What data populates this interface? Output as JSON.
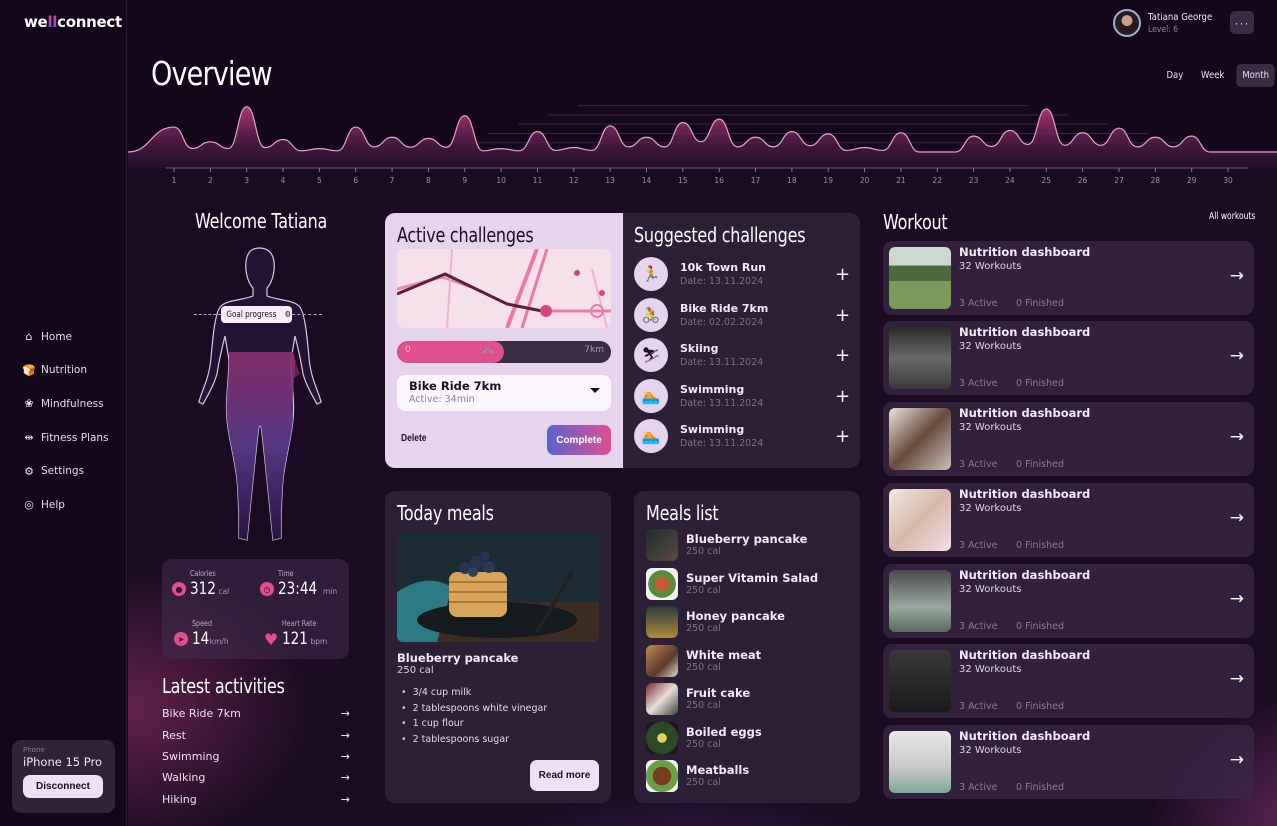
{
  "app": {
    "logo_prefix": "we",
    "logo_accent": "ll",
    "logo_suffix": "connect"
  },
  "user": {
    "name": "Tatiana George",
    "level": "Level: 6",
    "more_label": "···"
  },
  "header": {
    "title": "Overview",
    "ranges": [
      "Day",
      "Week",
      "Month"
    ],
    "active_range": "Month"
  },
  "sidebar": {
    "items": [
      {
        "label": "Home",
        "icon": "home-icon",
        "glyph": "⌂"
      },
      {
        "label": "Nutrition",
        "icon": "nutrition-icon",
        "glyph": "🍞"
      },
      {
        "label": "Mindfulness",
        "icon": "lotus-icon",
        "glyph": "❀"
      },
      {
        "label": "Fitness Plans",
        "icon": "dumbbell-icon",
        "glyph": "⇹"
      },
      {
        "label": "Settings",
        "icon": "gear-icon",
        "glyph": "⚙"
      },
      {
        "label": "Help",
        "icon": "lifebuoy-icon",
        "glyph": "◎"
      }
    ],
    "phone": {
      "label": "Phone",
      "device": "iPhone 15 Pro",
      "disconnect_label": "Disconnect"
    }
  },
  "chart_data": {
    "type": "area",
    "title": "",
    "x": [
      1,
      2,
      3,
      4,
      5,
      6,
      7,
      8,
      9,
      10,
      11,
      12,
      13,
      14,
      15,
      16,
      17,
      18,
      19,
      20,
      21,
      22,
      23,
      24,
      25,
      26,
      27,
      28,
      29,
      30
    ],
    "tick_labels": [
      "1",
      "2",
      "3",
      "4",
      "5",
      "6",
      "7",
      "8",
      "9",
      "10",
      "11",
      "12",
      "13",
      "14",
      "15",
      "16",
      "17",
      "18",
      "19",
      "20",
      "21",
      "22",
      "23",
      "24",
      "25",
      "26",
      "27",
      "28",
      "29",
      "30"
    ],
    "series": [
      {
        "name": "activity",
        "values": [
          2.2,
          0.9,
          4.0,
          1.1,
          0.3,
          2.2,
          1.3,
          1.2,
          3.2,
          0.3,
          1.8,
          0.4,
          2.3,
          1.3,
          2.6,
          2.9,
          1.3,
          1.8,
          1.6,
          0.4,
          1.7,
          0.0,
          1.4,
          1.9,
          3.8,
          1.7,
          2.1,
          1.3,
          1.4,
          0.0
        ]
      }
    ],
    "ylim": [
      0,
      4.5
    ],
    "grid": true,
    "legend": "none",
    "xlabel": "",
    "ylabel": ""
  },
  "welcome": {
    "title": "Welcome Tatiana",
    "goal_label": "Goal progress"
  },
  "stats": [
    {
      "label": "Calories",
      "value": "312",
      "unit": "cal",
      "icon": "flame-icon",
      "glyph": "🔥"
    },
    {
      "label": "Time",
      "value": "23:44",
      "unit": "min",
      "icon": "clock-icon",
      "glyph": "◷"
    },
    {
      "label": "Speed",
      "value": "14",
      "unit": "km/h",
      "icon": "compass-icon",
      "glyph": "➤"
    },
    {
      "label": "Heart Rate",
      "value": "121",
      "unit": "bpm",
      "icon": "heart-icon",
      "glyph": "♥"
    }
  ],
  "latest": {
    "title": "Latest activities",
    "items": [
      "Bike Ride 7km",
      "Rest",
      "Swimming",
      "Walking",
      "Hiking"
    ]
  },
  "active": {
    "title": "Active challenges",
    "progress_start": "0",
    "progress_end": "7km",
    "progress_fraction": 0.5,
    "selected_title": "Bike Ride 7km",
    "selected_sub": "Active: 34min",
    "delete_label": "Delete",
    "complete_label": "Complete"
  },
  "suggested": {
    "title": "Suggested challenges",
    "items": [
      {
        "title": "10k Town Run",
        "date": "Date: 13.11.2024",
        "icon": "running-icon",
        "glyph": "🏃"
      },
      {
        "title": "Bike Ride 7km",
        "date": "Date: 02.02.2024",
        "icon": "cycling-icon",
        "glyph": "🚴"
      },
      {
        "title": "Skiing",
        "date": "Date: 13.11.2024",
        "icon": "skiing-icon",
        "glyph": "⛷"
      },
      {
        "title": "Swimming",
        "date": "Date: 13.11.2024",
        "icon": "swimming-icon",
        "glyph": "🏊"
      },
      {
        "title": "Swimming",
        "date": "Date: 13.11.2024",
        "icon": "swimming-icon",
        "glyph": "🏊"
      }
    ]
  },
  "today": {
    "title": "Today meals",
    "meal_name": "Blueberry pancake",
    "meal_cal": "250 cal",
    "ingredients": [
      "3/4 cup milk",
      "2 tablespoons white vinegar",
      "1 cup flour",
      "2 tablespoons sugar"
    ],
    "read_more_label": "Read more"
  },
  "meals": {
    "title": "Meals list",
    "items": [
      {
        "name": "Blueberry pancake",
        "cal": "250 cal"
      },
      {
        "name": "Super Vitamin Salad",
        "cal": "250 cal"
      },
      {
        "name": "Honey pancake",
        "cal": "250 cal"
      },
      {
        "name": "White meat",
        "cal": "250 cal"
      },
      {
        "name": "Fruit cake",
        "cal": "250 cal"
      },
      {
        "name": "Boiled eggs",
        "cal": "250 cal"
      },
      {
        "name": "Meatballs",
        "cal": "250 cal"
      }
    ]
  },
  "workout": {
    "title": "Workout",
    "all_label": "All workouts",
    "items": [
      {
        "title": "Nutrition dashboard",
        "count": "32 Workouts",
        "active": "3 Active",
        "finished": "0 Finished"
      },
      {
        "title": "Nutrition dashboard",
        "count": "32 Workouts",
        "active": "3 Active",
        "finished": "0 Finished"
      },
      {
        "title": "Nutrition dashboard",
        "count": "32 Workouts",
        "active": "3 Active",
        "finished": "0 Finished"
      },
      {
        "title": "Nutrition dashboard",
        "count": "32 Workouts",
        "active": "3 Active",
        "finished": "0 Finished"
      },
      {
        "title": "Nutrition dashboard",
        "count": "32 Workouts",
        "active": "3 Active",
        "finished": "0 Finished"
      },
      {
        "title": "Nutrition dashboard",
        "count": "32 Workouts",
        "active": "3 Active",
        "finished": "0 Finished"
      },
      {
        "title": "Nutrition dashboard",
        "count": "32 Workouts",
        "active": "3 Active",
        "finished": "0 Finished"
      }
    ]
  }
}
